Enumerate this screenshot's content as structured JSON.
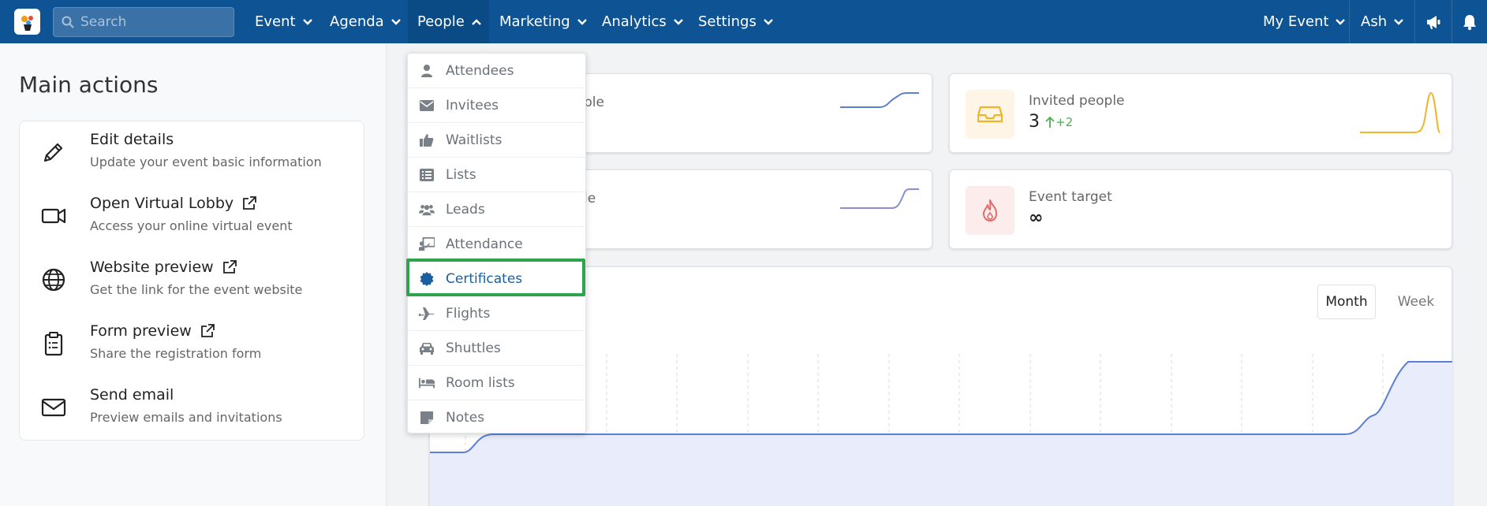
{
  "topbar": {
    "search_placeholder": "Search",
    "nav": [
      {
        "label": "Event"
      },
      {
        "label": "Agenda"
      },
      {
        "label": "People"
      },
      {
        "label": "Marketing"
      },
      {
        "label": "Analytics"
      },
      {
        "label": "Settings"
      }
    ],
    "right": [
      {
        "label": "My Event"
      },
      {
        "label": "Ash"
      }
    ]
  },
  "main_actions": {
    "heading": "Main actions",
    "items": [
      {
        "title": "Edit details",
        "desc": "Update your event basic information",
        "icon": "pencil-icon"
      },
      {
        "title": "Open Virtual Lobby",
        "desc": "Access your online virtual event",
        "icon": "video-camera-icon"
      },
      {
        "title": "Website preview",
        "desc": "Get the link for the event website",
        "icon": "globe-icon"
      },
      {
        "title": "Form preview",
        "desc": "Share the registration form",
        "icon": "clipboard-icon"
      },
      {
        "title": "Send email",
        "desc": "Preview emails and invitations",
        "icon": "envelope-icon"
      }
    ]
  },
  "stats": {
    "card1_partial_label": "ple",
    "card2_partial_label": "le",
    "invited": {
      "label": "Invited people",
      "value": "3",
      "delta": "+2"
    },
    "target": {
      "label": "Event target",
      "value": "∞"
    }
  },
  "chart": {
    "toggle_month": "Month",
    "toggle_week": "Week"
  },
  "people_menu": {
    "items": [
      {
        "label": "Attendees",
        "icon": "user-icon"
      },
      {
        "label": "Invitees",
        "icon": "envelope-icon"
      },
      {
        "label": "Waitlists",
        "icon": "thumbs-up-icon"
      },
      {
        "label": "Lists",
        "icon": "list-icon"
      },
      {
        "label": "Leads",
        "icon": "users-icon"
      },
      {
        "label": "Attendance",
        "icon": "attendance-icon"
      },
      {
        "label": "Certificates",
        "icon": "certificate-icon"
      },
      {
        "label": "Flights",
        "icon": "plane-icon"
      },
      {
        "label": "Shuttles",
        "icon": "car-icon"
      },
      {
        "label": "Room lists",
        "icon": "bed-icon"
      },
      {
        "label": "Notes",
        "icon": "note-icon"
      }
    ]
  },
  "colors": {
    "topbar": "#0e5393",
    "highlight_box": "#2ea44f",
    "chart_line": "#5c7ed6",
    "invited_line": "#f0b429"
  }
}
